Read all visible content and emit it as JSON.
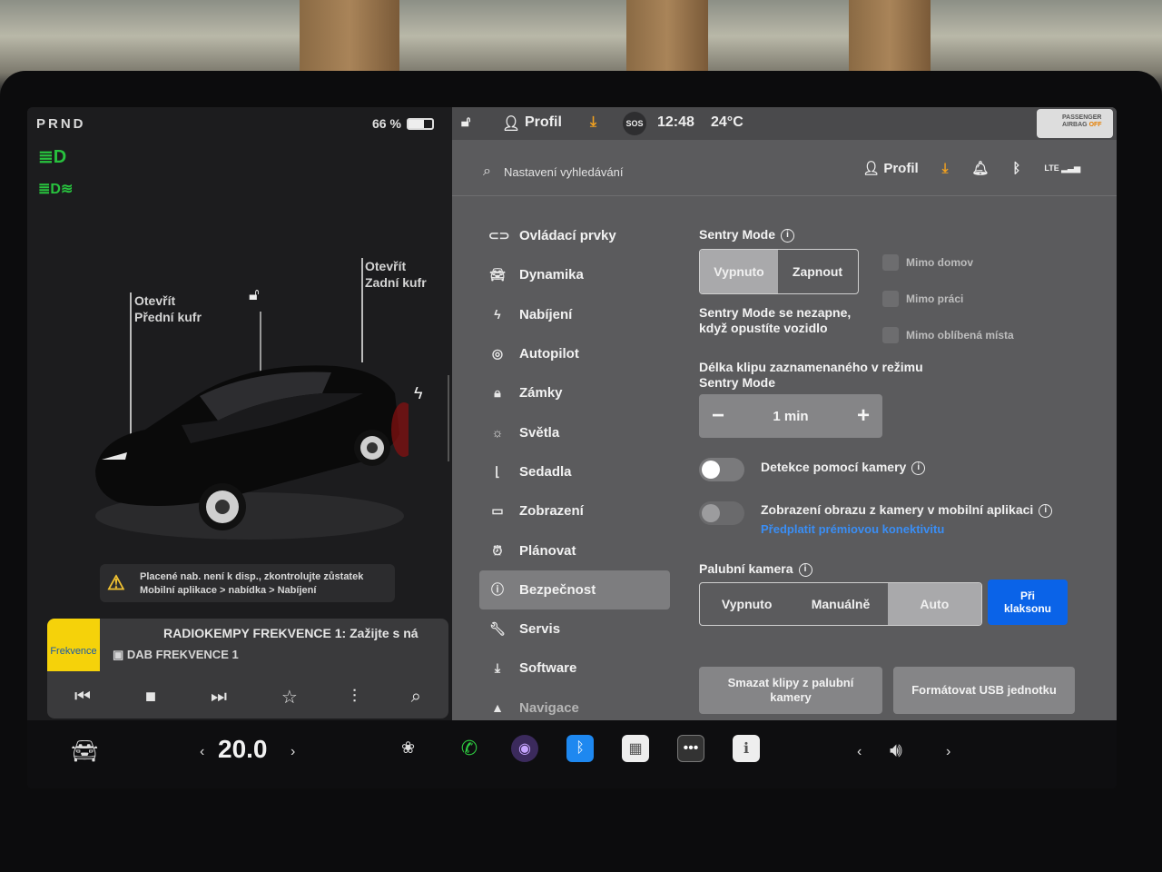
{
  "left_panel": {
    "gear": "PRND",
    "battery_percent_label": "66 %",
    "battery_level": 0.66,
    "front_trunk_callout": "Otevřít\nPřední kufr",
    "rear_trunk_callout": "Otevřít\nZadní kufr",
    "warning": {
      "line1": "Placené nab. není k disp., zkontrolujte zůstatek",
      "line2": "Mobilní aplikace > nabídka > Nabíjení"
    },
    "media": {
      "logo_text": "Frekvence",
      "title": "RADIOKEMPY FREKVENCE 1: Zažijte s ná",
      "source": "DAB FREKVENCE 1"
    }
  },
  "status_bar": {
    "profile_label": "Profil",
    "sos_label": "SOS",
    "time": "12:48",
    "temperature": "24°C",
    "airbag_line1": "PASSENGER",
    "airbag_line2": "AIRBAG",
    "airbag_state": "OFF"
  },
  "settings_header": {
    "search_placeholder": "Nastavení vyhledávání",
    "profile_label": "Profil",
    "lte_label": "LTE"
  },
  "nav": {
    "items": [
      {
        "label": "Ovládací prvky",
        "icon": "toggle-icon"
      },
      {
        "label": "Dynamika",
        "icon": "car-icon"
      },
      {
        "label": "Nabíjení",
        "icon": "bolt-icon"
      },
      {
        "label": "Autopilot",
        "icon": "steering-wheel-icon"
      },
      {
        "label": "Zámky",
        "icon": "lock-icon"
      },
      {
        "label": "Světla",
        "icon": "sun-icon"
      },
      {
        "label": "Sedadla",
        "icon": "seat-icon"
      },
      {
        "label": "Zobrazení",
        "icon": "display-icon"
      },
      {
        "label": "Plánovat",
        "icon": "alarm-icon"
      },
      {
        "label": "Bezpečnost",
        "icon": "shield-icon"
      },
      {
        "label": "Servis",
        "icon": "wrench-icon"
      },
      {
        "label": "Software",
        "icon": "download-icon"
      },
      {
        "label": "Navigace",
        "icon": "navigation-icon"
      }
    ],
    "active": "Bezpečnost"
  },
  "sentry": {
    "heading": "Sentry Mode",
    "options": [
      "Vypnuto",
      "Zapnout"
    ],
    "selected": "Vypnuto",
    "note": "Sentry Mode se nezapne,\nkdyž opustíte vozidlo",
    "exceptions": [
      "Mimo domov",
      "Mimo práci",
      "Mimo oblíbená místa"
    ],
    "clip_length_heading": "Délka klipu zaznamenaného v režimu\nSentry Mode",
    "clip_length_value": "1 min",
    "camera_detection_label": "Detekce pomocí kamery",
    "camera_detection_on": false,
    "mobile_view_label": "Zobrazení obrazu z kamery v mobilní aplikaci",
    "mobile_view_on": false,
    "subscribe_link": "Předplatit prémiovou konektivitu"
  },
  "dashcam": {
    "heading": "Palubní kamera",
    "options": [
      "Vypnuto",
      "Manuálně",
      "Auto",
      "Při klaksonu"
    ],
    "selected": "Auto",
    "highlighted": "Při klaksonu",
    "delete_button": "Smazat klipy z palubní\nkamery",
    "format_button": "Formátovat USB jednotku"
  },
  "dock": {
    "temperature": "20.0",
    "colors": {
      "phone": "#2ecc40",
      "bluetooth": "#1e88f0",
      "active_option": "#0a63e8"
    }
  }
}
